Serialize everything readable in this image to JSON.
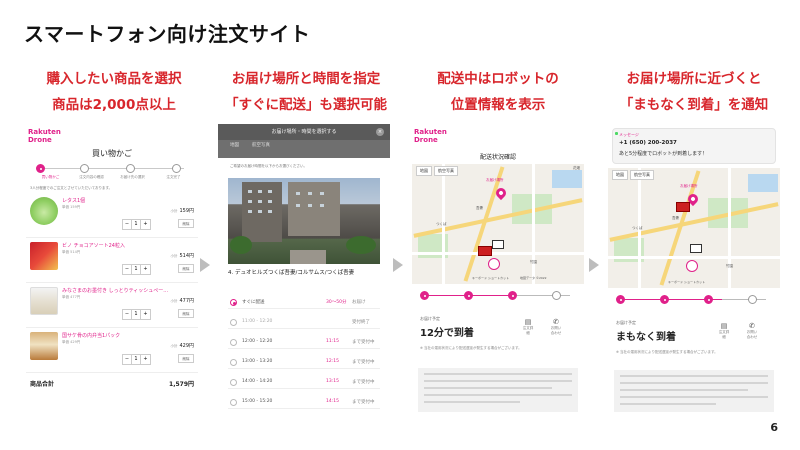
{
  "slide_title": "スマートフォン向け注文サイト",
  "page_number": "6",
  "accent_color": "#e0218a",
  "caption_color": "#d8262c",
  "captions": [
    {
      "line1": "購入したい商品を選択",
      "line2": "商品は2,000点以上"
    },
    {
      "line1": "お届け場所と時間を指定",
      "line2": "「すぐに配送」も選択可能"
    },
    {
      "line1": "配送中はロボットの",
      "line2": "位置情報を表示"
    },
    {
      "line1": "お届け場所に近づくと",
      "line2": "「まもなく到着」を通知"
    }
  ],
  "screen1": {
    "logo_line1": "Rakuten",
    "logo_line2": "Drone",
    "page_title": "買い物かご",
    "steps": [
      "買い物かご",
      "注文内容の確認",
      "お届け先の選択",
      "注文完了"
    ],
    "notice": "3人分程度でのご注文とさせていただいております。",
    "items": [
      {
        "name": "レタス1個",
        "sub": "単価 159円",
        "price": "159円",
        "icon": "lettuce-image"
      },
      {
        "name": "ビノ チョコアソート24粒入",
        "sub": "単価 514円",
        "price": "514円",
        "icon": "chocolate-box-image"
      },
      {
        "name": "みなさまのお墨付き しっとりティッシュペー...",
        "sub": "単価 477円",
        "price": "477円",
        "icon": "tissue-box-image"
      },
      {
        "name": "国サケ骨の内弁当1パック",
        "sub": "単価 429円",
        "price": "429円",
        "icon": "bento-image"
      }
    ],
    "price_prefix": "小計",
    "qty_value": "1",
    "minus_label": "−",
    "plus_label": "+",
    "delete_label": "削除",
    "total_label": "商品合計",
    "total_value": "1,579円"
  },
  "screen2": {
    "sheet_title": "お届け場所・時間を選択する",
    "close_label": "×",
    "tab1": "地図",
    "tab2": "航空写真",
    "hint": "ご希望のお届け時間を以下からお選びください。",
    "place_name": "4. デュオヒルズつくば吾妻/コルサムス/つくば吾妻",
    "slots": [
      {
        "label": "すぐに配送",
        "eta": "30～50分",
        "status": "お届け",
        "selected": true
      },
      {
        "label": "11:00 - 12:20",
        "eta": "",
        "status": "受付終了",
        "selected": false
      },
      {
        "label": "12:00 - 12:20",
        "eta": "11:15",
        "status": "まで受付中",
        "selected": false
      },
      {
        "label": "13:00 - 13:20",
        "eta": "12:15",
        "status": "まで受付中",
        "selected": false
      },
      {
        "label": "14:00 - 14:20",
        "eta": "13:15",
        "status": "まで受付中",
        "selected": false
      },
      {
        "label": "15:00 - 15:20",
        "eta": "14:15",
        "status": "まで受付中",
        "selected": false
      }
    ]
  },
  "screen3": {
    "logo_line1": "Rakuten",
    "logo_line2": "Drone",
    "page_title": "配送状況確認",
    "map_tab1": "地図",
    "map_tab2": "航空写真",
    "map_extra": "花畑",
    "map_labels": [
      "お届け場所",
      "吾妻",
      "つくば",
      "竹園",
      "キーボード ショートカット",
      "地図データ ©2022"
    ],
    "eta_label": "お届け予定",
    "eta_value": "12分で到着",
    "action1": "注文詳細",
    "action2": "お問い合わせ",
    "note": "※ 当社の運用状況により配送遅延が発生する場合がございます。"
  },
  "screen4": {
    "notif_app": "メッセージ",
    "notif_number": "+1 (650) 200-2037",
    "notif_message": "あと5分程度でロボットが到着します！",
    "map_tab1": "地図",
    "map_tab2": "航空写真",
    "map_labels": [
      "お届け場所",
      "吾妻",
      "つくば",
      "竹園",
      "キーボード ショートカット"
    ],
    "eta_label": "お届け予定",
    "eta_value": "まもなく到着",
    "action1": "注文詳細",
    "action2": "お問い合わせ",
    "note": "※ 当社の運用状況により配送遅延が発生する場合がございます。"
  }
}
